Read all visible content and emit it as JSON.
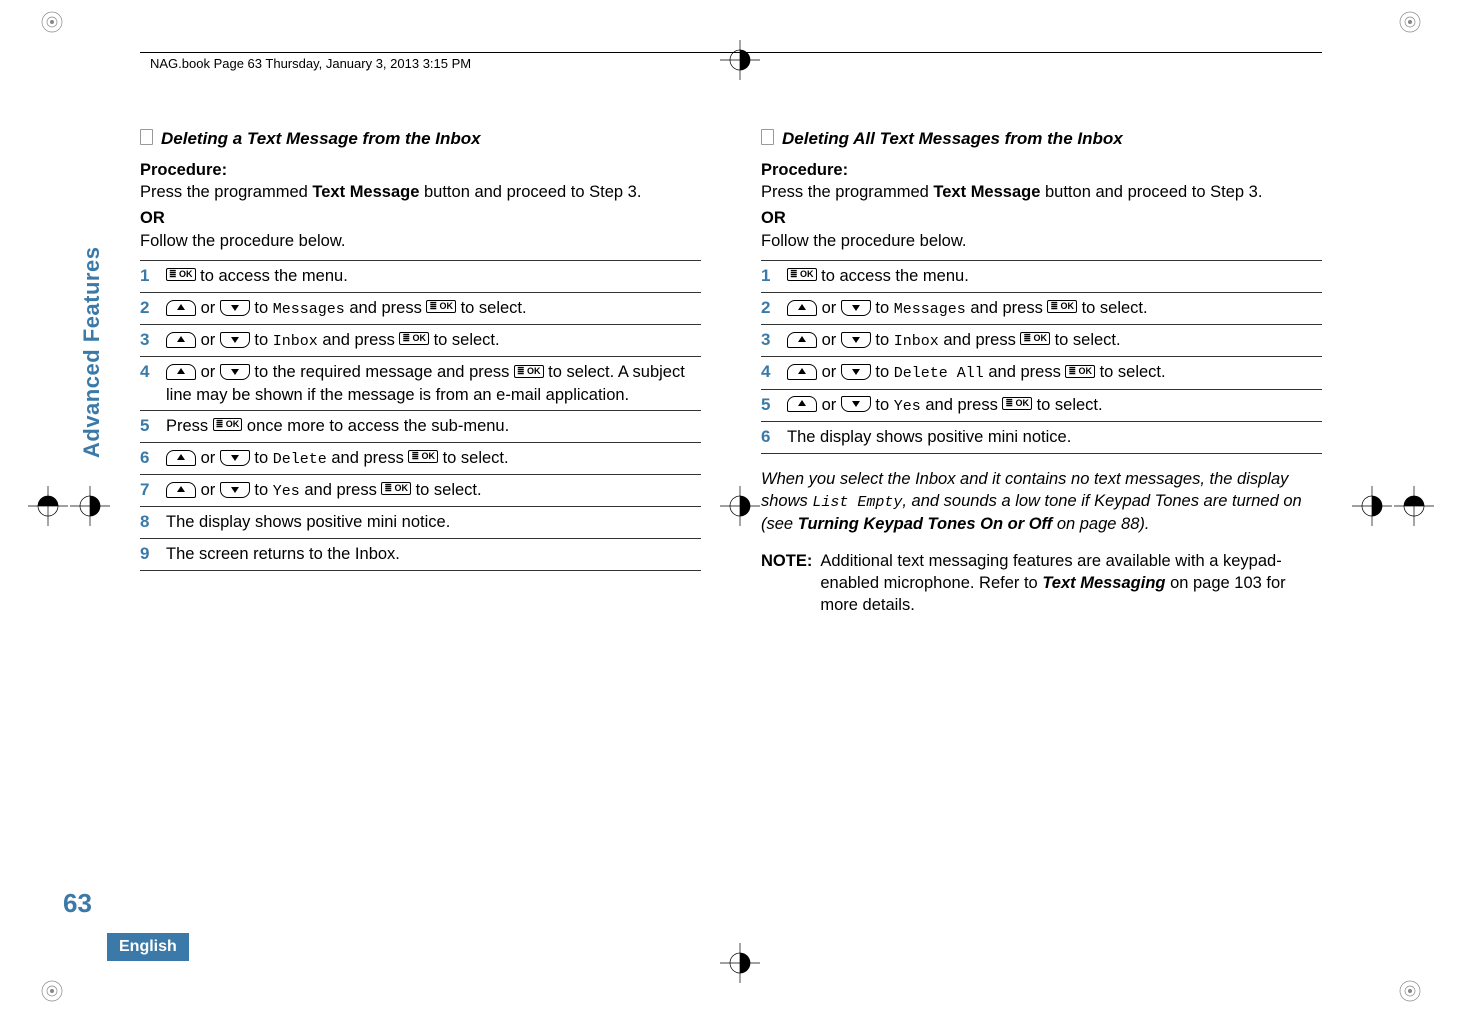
{
  "header": {
    "running": "NAG.book  Page 63  Thursday, January 3, 2013  3:15 PM"
  },
  "sidebar": {
    "tab": "Advanced Features",
    "pagenum": "63",
    "lang": "English"
  },
  "glyphs": {
    "ok": "≣ OK"
  },
  "left": {
    "title": "Deleting a Text Message from the Inbox",
    "proc_label": "Procedure:",
    "intro1a": "Press the programmed ",
    "intro1b": "Text Message",
    "intro1c": " button and proceed to Step 3.",
    "or": "OR",
    "intro2": "Follow the procedure below.",
    "steps": {
      "s1": {
        "a": " to access the menu."
      },
      "s2": {
        "a": " or ",
        "b": " to ",
        "menu": "Messages",
        "c": " and press ",
        "d": " to select."
      },
      "s3": {
        "a": " or ",
        "b": " to ",
        "menu": "Inbox",
        "c": " and press ",
        "d": " to select."
      },
      "s4": {
        "a": " or ",
        "b": " to the required message and press ",
        "c": " to select. A subject line may be shown if the message is from an e-mail application."
      },
      "s5": {
        "a": "Press ",
        "b": " once more to access the sub-menu."
      },
      "s6": {
        "a": " or ",
        "b": " to ",
        "menu": "Delete",
        "c": " and press ",
        "d": " to select."
      },
      "s7": {
        "a": " or ",
        "b": " to ",
        "menu": "Yes",
        "c": " and press ",
        "d": " to select."
      },
      "s8": {
        "a": "The display shows positive mini notice."
      },
      "s9": {
        "a": "The screen returns to the Inbox."
      }
    }
  },
  "right": {
    "title": "Deleting All Text Messages from the Inbox",
    "proc_label": "Procedure:",
    "intro1a": "Press the programmed ",
    "intro1b": "Text Message",
    "intro1c": " button and proceed to Step 3.",
    "or": "OR",
    "intro2": "Follow the procedure below.",
    "steps": {
      "s1": {
        "a": " to access the menu."
      },
      "s2": {
        "a": " or ",
        "b": " to ",
        "menu": "Messages",
        "c": " and press ",
        "d": " to select."
      },
      "s3": {
        "a": " or ",
        "b": " to ",
        "menu": "Inbox",
        "c": " and press ",
        "d": " to select."
      },
      "s4": {
        "a": " or ",
        "b": " to ",
        "menu": "Delete All",
        "c": " and press ",
        "d": " to select."
      },
      "s5": {
        "a": " or ",
        "b": " to ",
        "menu": "Yes",
        "c": " and press ",
        "d": " to select."
      },
      "s6": {
        "a": "The display shows positive mini notice."
      }
    },
    "note_block": {
      "a": "When you select the Inbox and it contains no text messages, the display shows ",
      "mono": "List Empty",
      "b": ", and sounds a low tone if Keypad Tones are turned on (see ",
      "bold1": "Turning Keypad Tones On or Off",
      "c": " on page 88)."
    },
    "note": {
      "label": "NOTE:",
      "a": "Additional text messaging features are available with a keypad-enabled microphone. Refer to ",
      "bold1": "Text Messaging",
      "b": " on page 103 for more details."
    }
  }
}
